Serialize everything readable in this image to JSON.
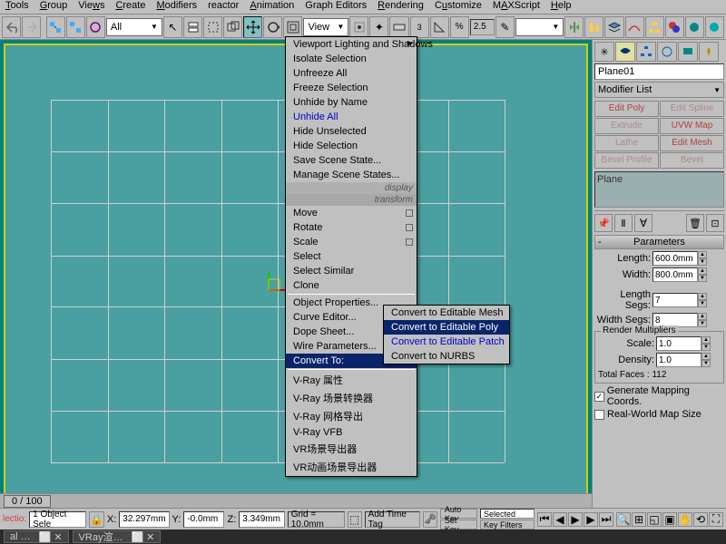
{
  "menubar": [
    "Tools",
    "Group",
    "Views",
    "Create",
    "Modifiers",
    "reactor",
    "Animation",
    "Graph Editors",
    "Rendering",
    "Customize",
    "MAXScript",
    "Help"
  ],
  "toolbar": {
    "combo_all": "All",
    "view_label": "View",
    "spin_value": "2.5"
  },
  "context_menu1": {
    "section_display": "display",
    "section_transform": "transform",
    "items": [
      "Viewport Lighting and Shadows",
      "Isolate Selection",
      "Unfreeze All",
      "Freeze Selection",
      "Unhide by Name",
      "Unhide All",
      "Hide Unselected",
      "Hide Selection",
      "Save Scene State...",
      "Manage Scene States..."
    ],
    "transform_items": [
      "Move",
      "Rotate",
      "Scale",
      "Select",
      "Select Similar",
      "Clone",
      "Object Properties...",
      "Curve Editor...",
      "Dope Sheet...",
      "Wire Parameters..."
    ],
    "convert_to": "Convert To:",
    "vray_items": [
      "V-Ray 属性",
      "V-Ray 场景转换器",
      "V-Ray 网格导出",
      "V-Ray VFB",
      "VR场景导出器",
      "VR动画场景导出器"
    ]
  },
  "submenu": {
    "items": [
      "Convert to Editable Mesh",
      "Convert to Editable Poly",
      "Convert to Editable Patch",
      "Convert to NURBS"
    ]
  },
  "panel": {
    "object_name": "Plane01",
    "modifier_list": "Modifier List",
    "mod_buttons": [
      "Edit Poly",
      "Edit Spline",
      "Extrude",
      "UVW Map",
      "Lathe",
      "Edit Mesh",
      "Bevel Profile",
      "Bevel"
    ],
    "stack_item": "Plane",
    "rollout": "Parameters",
    "length_label": "Length:",
    "length_val": "600.0mm",
    "width_label": "Width:",
    "width_val": "800.0mm",
    "lsegs_label": "Length Segs:",
    "lsegs_val": "7",
    "wsegs_label": "Width Segs:",
    "wsegs_val": "8",
    "render_mult": "Render Multipliers",
    "scale_label": "Scale:",
    "scale_val": "1.0",
    "density_label": "Density:",
    "density_val": "1.0",
    "total_faces": "Total Faces : 112",
    "gen_map": "Generate Mapping Coords.",
    "real_world": "Real-World Map Size"
  },
  "timeline": {
    "frame": "0 / 100"
  },
  "status": {
    "selection": "1 Object Sele",
    "x_label": "X:",
    "x_val": "32.297mm",
    "y_label": "Y:",
    "y_val": "-0.0mm",
    "z_label": "Z:",
    "z_val": "3.349mm",
    "grid": "Grid = 10.0mm",
    "autokey": "Auto Key",
    "setkey": "Set Key",
    "selected": "Selected",
    "keyfilters": "Key Filters",
    "addtag": "Add Time Tag",
    "lectio": "lectio:"
  },
  "taskbar": {
    "item1": "al …",
    "item2": "VRay渲…"
  }
}
